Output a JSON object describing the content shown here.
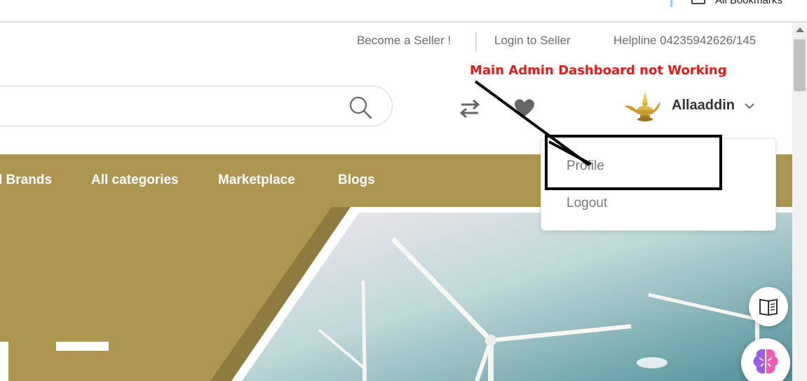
{
  "browser": {
    "bookmarks_label": "All Bookmarks"
  },
  "header": {
    "become_seller": "Become a Seller !",
    "login_seller": "Login to Seller",
    "helpline": "Helpline 04235942626/145"
  },
  "search": {
    "placeholder": ""
  },
  "user": {
    "name": "Allaaddin"
  },
  "nav": {
    "items": [
      "l Brands",
      "All categories",
      "Marketplace",
      "Blogs"
    ]
  },
  "user_menu": {
    "items": [
      "Profile",
      "Logout"
    ]
  },
  "annotation": {
    "text": "Main Admin Dashboard not Working"
  },
  "colors": {
    "navbar": "#ac9650",
    "annotation": "#e01b1b"
  },
  "icons": [
    "search-icon",
    "compare-icon",
    "heart-icon",
    "chevron-down-icon",
    "book-icon",
    "brain-icon",
    "folder-icon"
  ]
}
